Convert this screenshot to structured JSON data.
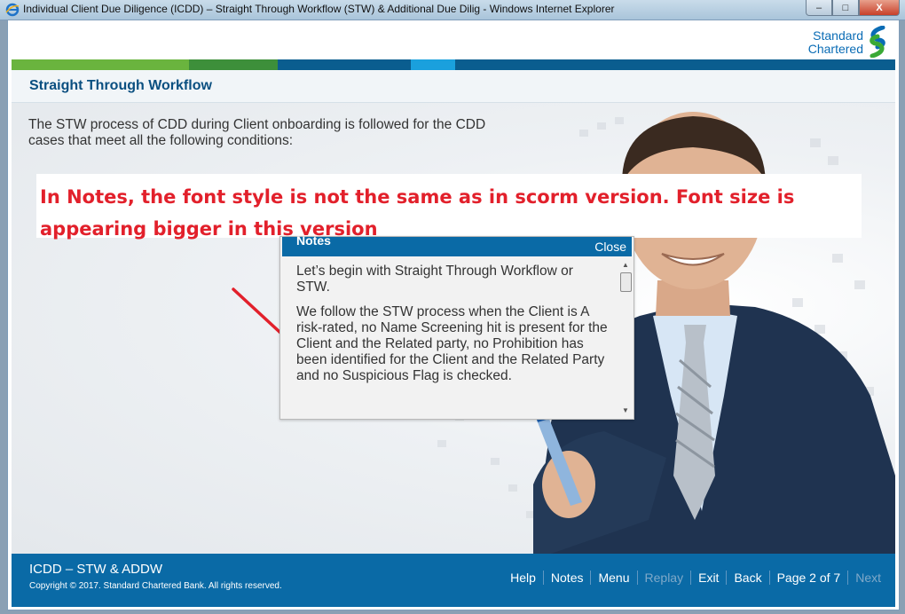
{
  "window": {
    "title": "Individual Client Due Diligence (ICDD) – Straight Through Workflow (STW) & Additional Due Dilig - Windows Internet Explorer",
    "min_label": "–",
    "max_label": "□",
    "close_label": "X"
  },
  "brand": {
    "line1": "Standard",
    "line2": "Chartered"
  },
  "stripe_colors": [
    "#6ab43e",
    "#3d8f3a",
    "#0a5d8f",
    "#1a7cc0",
    "#0a5d8f"
  ],
  "page": {
    "title": "Straight Through Workflow"
  },
  "intro": "The STW process of CDD during Client onboarding is followed for the CDD cases that meet all the following conditions:",
  "annotation": "In Notes, the font style is not the same as in scorm version. Font size is appearing bigger in this version",
  "notes": {
    "title": "Notes",
    "close": "Close",
    "paragraphs": [
      "Let’s begin with Straight Through Workflow or STW.",
      "We follow the STW process when the Client is A risk-rated, no Name Screening hit is present for the Client and the Related party, no Prohibition has been identified for the Client and the Related Party and no Suspicious Flag is checked."
    ]
  },
  "footer": {
    "course_title": "ICDD – STW & ADDW",
    "copyright": "Copyright © 2017. Standard Chartered Bank. All rights reserved.",
    "nav": {
      "help": "Help",
      "notes": "Notes",
      "menu": "Menu",
      "replay": "Replay",
      "exit": "Exit",
      "back": "Back",
      "page": "Page 2 of 7",
      "next": "Next"
    }
  },
  "colors": {
    "accent_blue": "#0a6aa6",
    "title_blue": "#0a4f80",
    "annotation_red": "#e2202b"
  }
}
